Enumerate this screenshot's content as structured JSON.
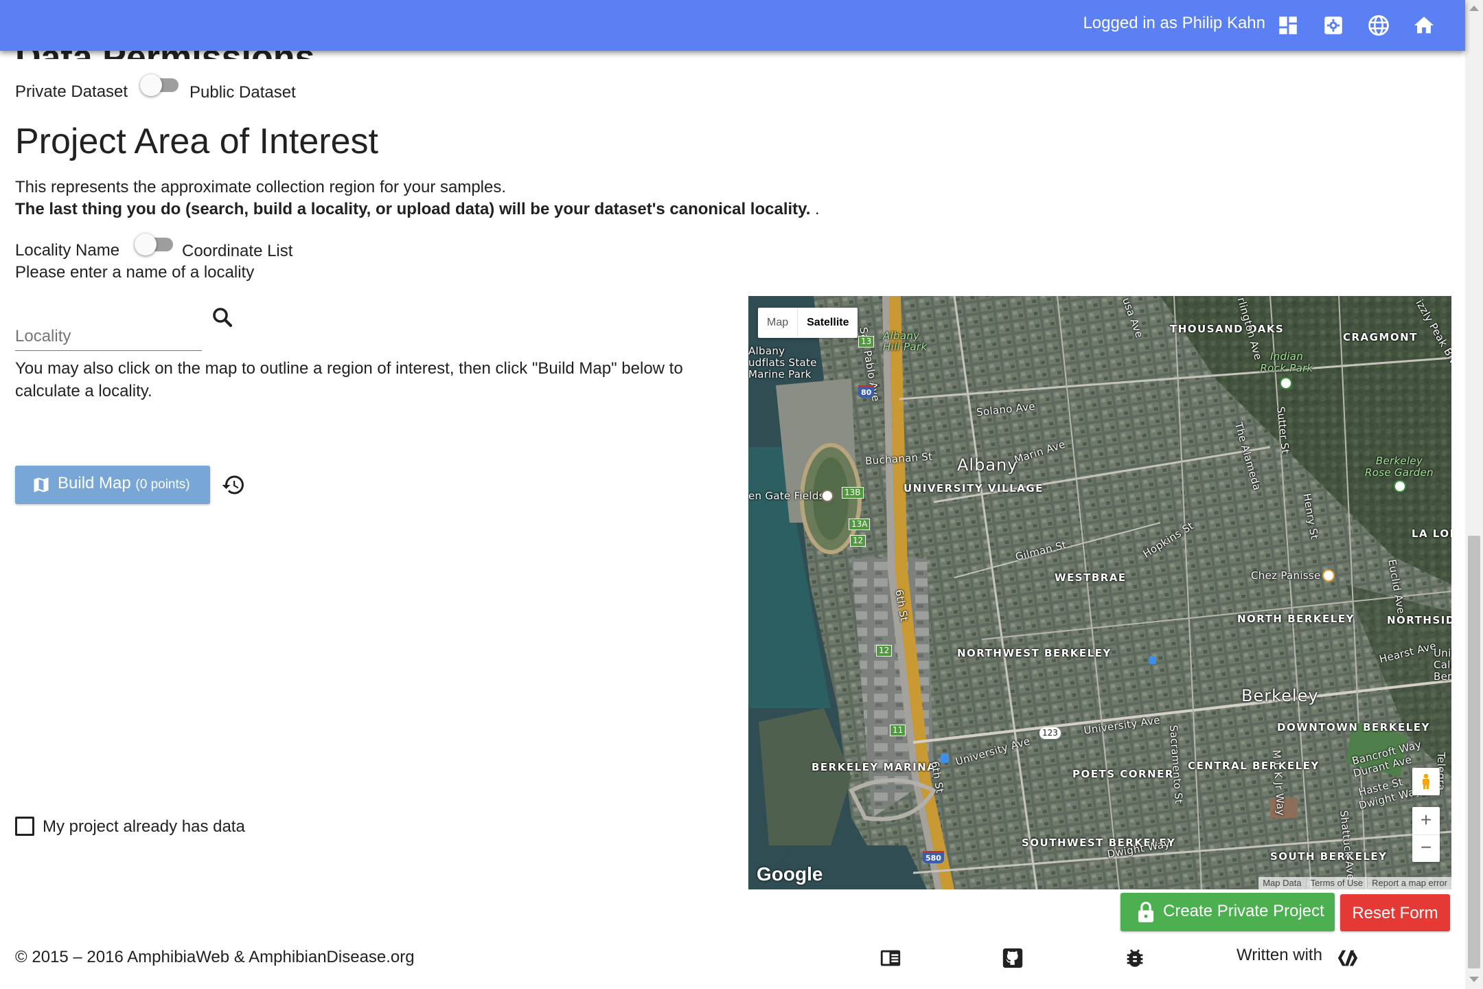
{
  "header": {
    "user_text": "Logged in as Philip Kahn",
    "icons": [
      "dashboard-icon",
      "settings-icon",
      "globe-icon",
      "home-icon"
    ],
    "bar_color": "#5b80f3"
  },
  "permissions": {
    "heading": "Data Permissions",
    "left_label": "Private Dataset",
    "right_label": "Public Dataset"
  },
  "area": {
    "title": "Project Area of Interest",
    "intro": "This represents the approximate collection region for your samples.",
    "note_bold": "The last thing you do (search, build a locality, or upload data) will be your dataset's canonical locality.",
    "note_tail": " .",
    "toggle_left": "Locality Name",
    "toggle_right": "Coordinate List",
    "prompt": "Please enter a name of a locality",
    "locality_placeholder": "Locality",
    "locality_value": "",
    "map_hint": "You may also click on the map to outline a region of interest, then click \"Build Map\" below to calculate a locality.",
    "build_label": "Build Map",
    "build_count": "(0 points)",
    "has_data_label": "My project already has data"
  },
  "map": {
    "type_map": "Map",
    "type_satellite": "Satellite",
    "google": "Google",
    "footer_data": "Map Data",
    "footer_terms": "Terms of Use",
    "footer_report": "Report a map error",
    "zoom_in": "+",
    "zoom_out": "−",
    "labels": {
      "albany": "Albany",
      "berkeley": "Berkeley",
      "thousand_oaks": "THOUSAND OAKS",
      "cragmont": "CRAGMONT",
      "university_village": "UNIVERSITY VILLAGE",
      "westbrae": "WESTBRAE",
      "north_berkeley": "NORTH BERKELEY",
      "northwest_berkeley": "NORTHWEST BERKELEY",
      "berkeley_marina": "BERKELEY MARINA",
      "poets_corner": "POETS CORNER",
      "central_berkeley": "CENTRAL BERKELEY",
      "downtown_berkeley": "DOWNTOWN BERKELEY",
      "southwest_berkeley": "SOUTHWEST BERKELEY",
      "south_berkeley": "SOUTH BERKELEY",
      "la_lom": "LA LOM",
      "northside": "NORTHSID",
      "albany_hill_park": "Albany Hill Park",
      "albany_mudflats": "Albany udflats State Marine Park",
      "indian_rock_park": "Indian Rock Park",
      "rose_garden": "Berkeley Rose Garden",
      "golden_gate_fields": "en Gate Fields",
      "chez_panisse": "Chez Panisse",
      "solano": "Solano Ave",
      "buchanan": "Buchanan St",
      "marin": "Marin Ave",
      "gilman": "Gilman St",
      "hopkins": "Hopkins St",
      "university_ave": "University Ave",
      "university_ave_2": "University Ave",
      "dwight": "Dwight Way",
      "dwight_2": "Dwight Way",
      "bancroft": "Bancroft Way",
      "durant": "Durant Ave",
      "haste": "Haste St",
      "hearst": "Hearst Ave",
      "san_pablo": "San Pablo Ave",
      "sixth_st": "6th St",
      "sixth_st_2": "6th St",
      "sacramento": "Sacramento St",
      "mlk": "M L K Jr Way",
      "shattuck": "Shattuck Ave",
      "sutter": "Sutter St",
      "henry": "Henry St",
      "the_alameda": "The Alameda",
      "euclid": "Euclid Ave",
      "arlington": "rlington Ave",
      "grizzly": "izzly Peak Blvd",
      "colusa": "usa Ave",
      "telegraph": "Telegra",
      "univ_calif": "Unive Calif Berk"
    },
    "shields": {
      "s13": "13",
      "s80": "80",
      "s13b": "13B",
      "s13a": "13A",
      "s12a": "12",
      "s12b": "12",
      "s11": "11",
      "s123": "123",
      "s580": "580"
    }
  },
  "actions": {
    "create": "Create Private Project",
    "reset": "Reset Form",
    "create_color": "#4caf50",
    "reset_color": "#e53935"
  },
  "footer": {
    "copyright": "© 2015 – 2016 AmphibiaWeb & AmphibianDisease.org",
    "written_with": "Written with",
    "icons": [
      "docs-icon",
      "github-icon",
      "bug-icon",
      "polymer-icon"
    ]
  }
}
